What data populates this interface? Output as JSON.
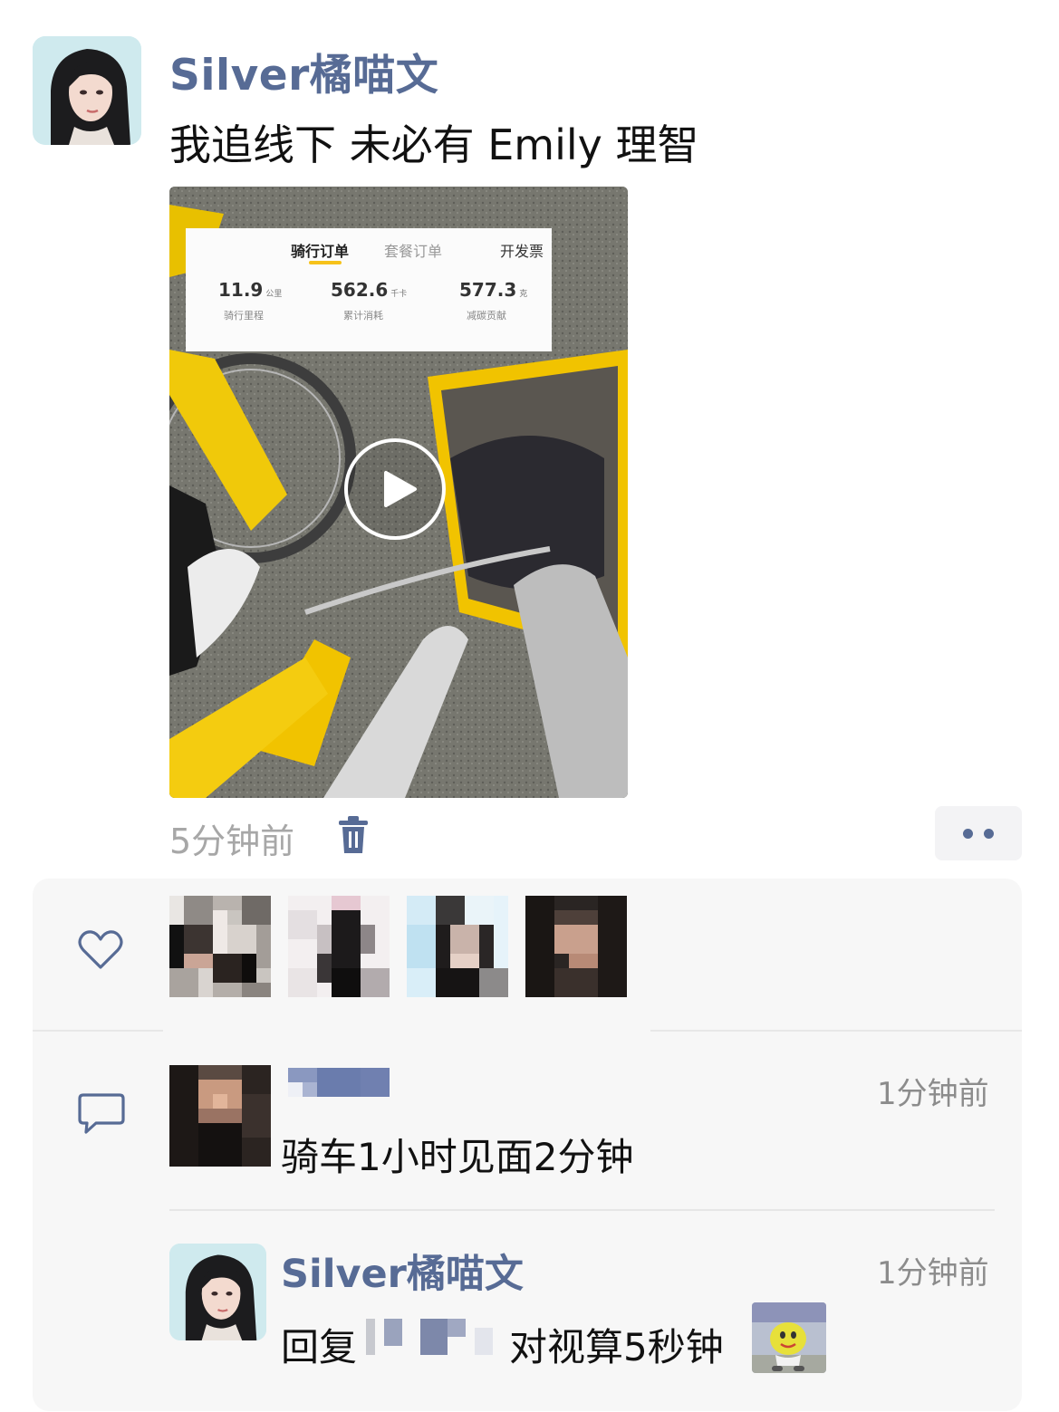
{
  "post": {
    "author_name": "Silver橘喵文",
    "text": "我追线下 未必有 Emily 理智",
    "time": "5分钟前",
    "video": {
      "tabs": [
        "骑行订单",
        "套餐订单",
        "开发票"
      ],
      "active_tab": "骑行订单",
      "stats": [
        {
          "value": "11.9",
          "unit": "公里",
          "label": "骑行里程"
        },
        {
          "value": "562.6",
          "unit": "千卡",
          "label": "累计消耗"
        },
        {
          "value": "577.3",
          "unit": "克",
          "label": "减碳贡献"
        }
      ]
    }
  },
  "icons": {
    "trash": "trash-icon",
    "more": "more-dots-icon",
    "like": "heart-outline-icon",
    "comment": "comment-bubble-icon",
    "play": "play-icon"
  },
  "likes": {
    "count_visible": 4
  },
  "comments": [
    {
      "author": "",
      "time": "1分钟前",
      "text": "骑车1小时见面2分钟"
    },
    {
      "author": "Silver橘喵文",
      "time": "1分钟前",
      "reply_prefix": "回复",
      "text": "对视算5秒钟"
    }
  ],
  "colors": {
    "link_blue": "#576b95",
    "panel_bg": "#f7f7f7",
    "bike_yellow": "#f5c400"
  }
}
